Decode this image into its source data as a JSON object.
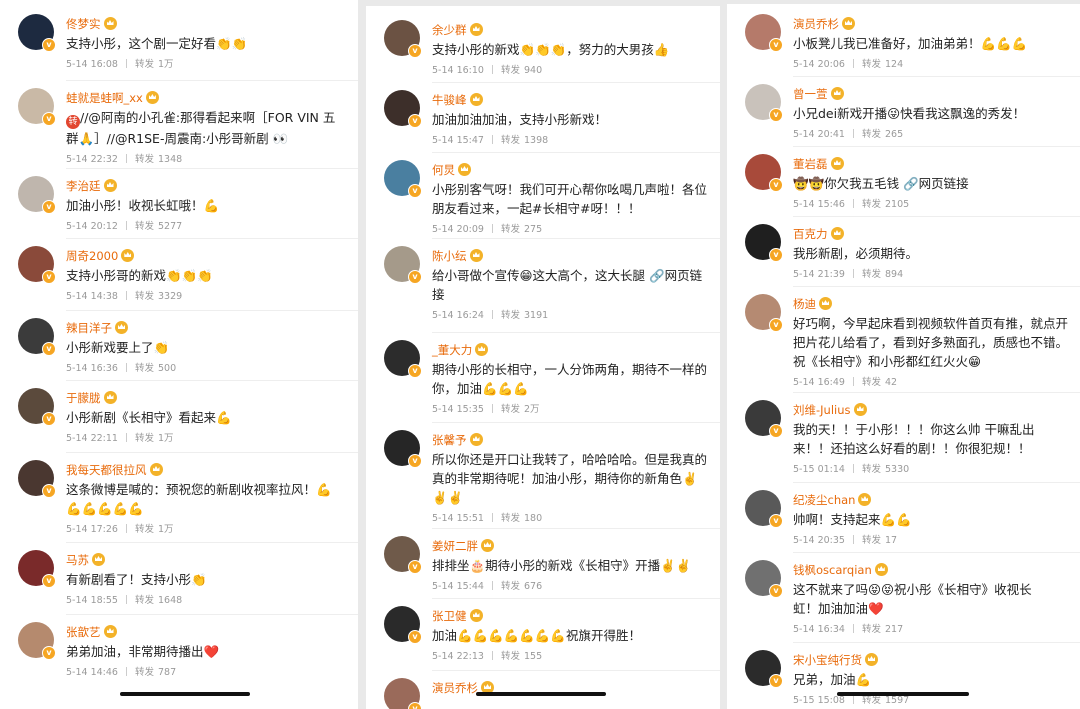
{
  "meta_label": "转发",
  "columns": [
    {
      "comments": [
        {
          "user": "佟梦实",
          "lines": [
            "支持小彤，这个剧一定好看👏👏"
          ],
          "date": "5-14 16:08",
          "reposts": "1万",
          "avatar_color": "#1d2a40"
        },
        {
          "user": "蛙就是蛙啊_xx",
          "lines": [
            "//@阿南的小孔雀:那得看起来啊［FOR VIN 五",
            "群🙏］//@R1SE-周震南:小彤哥新剧 👀"
          ],
          "date": "5-14 22:32",
          "reposts": "1348",
          "avatar_color": "#c9b9a6",
          "repost_badge": "转"
        },
        {
          "user": "李治廷",
          "lines": [
            "加油小彤！收视长虹哦！💪"
          ],
          "date": "5-14 20:12",
          "reposts": "5277",
          "avatar_color": "#bfb6ad"
        },
        {
          "user": "周奇2000",
          "lines": [
            "支持小彤哥的新戏👏👏👏"
          ],
          "date": "5-14 14:38",
          "reposts": "3329",
          "avatar_color": "#8a4a3a"
        },
        {
          "user": "辣目洋子",
          "lines": [
            "小彤新戏要上了👏"
          ],
          "date": "5-14 16:36",
          "reposts": "500",
          "avatar_color": "#3b3b3b"
        },
        {
          "user": "于朦胧",
          "lines": [
            "小彤新剧《长相守》看起来💪"
          ],
          "date": "5-14 22:11",
          "reposts": "1万",
          "avatar_color": "#5b4a3c"
        },
        {
          "user": "我每天都很拉风",
          "lines": [
            "这条微博是喊的：预祝您的新剧收视率拉风！💪",
            "💪💪💪💪💪"
          ],
          "date": "5-14 17:26",
          "reposts": "1万",
          "avatar_color": "#4a3730"
        },
        {
          "user": "马苏",
          "lines": [
            "有新剧看了！支持小彤👏"
          ],
          "date": "5-14 18:55",
          "reposts": "1648",
          "avatar_color": "#7a2a2a"
        },
        {
          "user": "张歆艺",
          "lines": [
            "弟弟加油，非常期待播出❤️"
          ],
          "date": "5-14 14:46",
          "reposts": "787",
          "avatar_color": "#b58a6e"
        }
      ]
    },
    {
      "comments": [
        {
          "user": "余少群",
          "lines": [
            "支持小彤的新戏👏👏👏，努力的大男孩👍"
          ],
          "date": "5-14 16:10",
          "reposts": "940",
          "avatar_color": "#6b5243"
        },
        {
          "user": "牛骏峰",
          "lines": [
            "加油加油加油，支持小彤新戏！"
          ],
          "date": "5-14 15:47",
          "reposts": "1398",
          "avatar_color": "#3d2f2a"
        },
        {
          "user": "何炅",
          "lines": [
            "小彤别客气呀！我们可开心帮你吆喝几声啦！各位",
            "朋友看过来，一起#长相守#呀！！！"
          ],
          "date": "5-14 20:09",
          "reposts": "275",
          "avatar_color": "#4a7fa0"
        },
        {
          "user": "陈小纭",
          "lines": [
            "给小哥做个宣传😁这大高个，这大长腿 🔗网页链",
            "接"
          ],
          "date": "5-14 16:24",
          "reposts": "3191",
          "avatar_color": "#a59a8a"
        },
        {
          "user": "_董大力",
          "lines": [
            "期待小彤的长相守，一人分饰两角，期待不一样的",
            "你，加油💪💪💪"
          ],
          "date": "5-14 15:35",
          "reposts": "2万",
          "avatar_color": "#2c2c2c"
        },
        {
          "user": "张馨予",
          "lines": [
            "所以你还是开口让我转了，哈哈哈哈。但是我真的",
            "真的非常期待呢！加油小彤，期待你的新角色✌️",
            "✌️✌️"
          ],
          "date": "5-14 15:51",
          "reposts": "180",
          "avatar_color": "#262626"
        },
        {
          "user": "姜妍二胖",
          "lines": [
            "排排坐🎂期待小彤的新戏《长相守》开播✌️✌️"
          ],
          "date": "5-14 15:44",
          "reposts": "676",
          "avatar_color": "#6f5a4a"
        },
        {
          "user": "张卫健",
          "lines": [
            "加油💪💪💪💪💪💪💪祝旗开得胜！"
          ],
          "date": "5-14 22:13",
          "reposts": "155",
          "avatar_color": "#2a2a2a"
        },
        {
          "user": "演员乔杉",
          "lines": [
            ""
          ],
          "date": "",
          "reposts": "",
          "avatar_color": "#9a6a5a"
        }
      ]
    },
    {
      "comments": [
        {
          "user": "演员乔杉",
          "lines": [
            "小板凳儿我已准备好，加油弟弟！💪💪💪"
          ],
          "date": "5-14 20:06",
          "reposts": "124",
          "avatar_color": "#b57a6a"
        },
        {
          "user": "曾一萱",
          "lines": [
            "小兄dei新戏开播😜快看我这飘逸的秀发！"
          ],
          "date": "5-14 20:41",
          "reposts": "265",
          "avatar_color": "#c9c2bb"
        },
        {
          "user": "董岩磊",
          "lines": [
            "🤠🤠你欠我五毛钱 🔗网页链接"
          ],
          "date": "5-14 15:46",
          "reposts": "2105",
          "avatar_color": "#a84a3a"
        },
        {
          "user": "百克力",
          "lines": [
            "我彤新剧，必须期待。"
          ],
          "date": "5-14 21:39",
          "reposts": "894",
          "avatar_color": "#1f1f1f"
        },
        {
          "user": "杨迪",
          "lines": [
            "好巧啊，今早起床看到视频软件首页有推，就点开",
            "把片花儿给看了，看到好多熟面孔，质感也不错。",
            "祝《长相守》和小彤都红红火火😁"
          ],
          "date": "5-14 16:49",
          "reposts": "42",
          "avatar_color": "#b58a72"
        },
        {
          "user": "刘维-Julius",
          "lines": [
            "我的天！！于小彤！！！你这么帅 干嘛乱出",
            "来！！还拍这么好看的剧！！你很犯规！！"
          ],
          "date": "5-15 01:14",
          "reposts": "5330",
          "avatar_color": "#3a3a3a"
        },
        {
          "user": "纪凌尘chan",
          "lines": [
            "帅啊！支持起来💪💪"
          ],
          "date": "5-14 20:35",
          "reposts": "17",
          "avatar_color": "#595959"
        },
        {
          "user": "钱枫oscarqian",
          "lines": [
            "这不就来了吗😝😝祝小彤《长相守》收视长",
            "虹！加油加油❤️"
          ],
          "date": "5-14 16:34",
          "reposts": "217",
          "avatar_color": "#707070"
        },
        {
          "user": "宋小宝纯行货",
          "lines": [
            "兄弟，加油💪"
          ],
          "date": "5-15 15:08",
          "reposts": "1597",
          "avatar_color": "#2b2b2b"
        }
      ]
    }
  ]
}
